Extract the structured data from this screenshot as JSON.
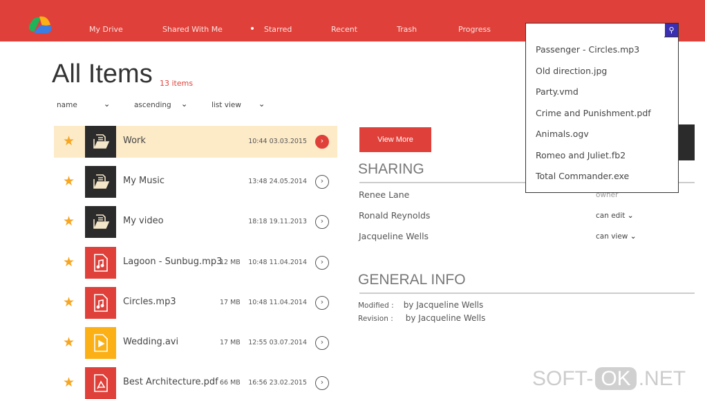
{
  "header": {
    "nav": [
      "My Drive",
      "Shared With Me",
      "Starred",
      "Recent",
      "Trash",
      "Progress"
    ],
    "search_value": "",
    "search_icon": "search-icon"
  },
  "search_suggestions": [
    "Passenger - Circles.mp3",
    "Old direction.jpg",
    "Party.vmd",
    "Crime and Punishment.pdf",
    "Animals.ogv",
    "Romeo and Juliet.fb2",
    "Total Commander.exe"
  ],
  "page": {
    "title": "All Items",
    "count": "13 items",
    "sort_field": "name",
    "sort_order": "ascending",
    "view": "list view"
  },
  "files": [
    {
      "name": "Work",
      "size": "",
      "date": "10:44 03.03.2015",
      "type": "folder",
      "color": "#2b2b2b"
    },
    {
      "name": "My Music",
      "size": "",
      "date": "13:48 24.05.2014",
      "type": "folder",
      "color": "#2b2b2b"
    },
    {
      "name": "My video",
      "size": "",
      "date": "18:18 19.11.2013",
      "type": "folder",
      "color": "#2b2b2b"
    },
    {
      "name": "Lagoon - Sunbug.mp3",
      "size": "12 MB",
      "date": "10:48 11.04.2014",
      "type": "audio",
      "color": "#e0403a"
    },
    {
      "name": "Circles.mp3",
      "size": "17 MB",
      "date": "10:48 11.04.2014",
      "type": "audio",
      "color": "#e0403a"
    },
    {
      "name": "Wedding.avi",
      "size": "17 MB",
      "date": "12:55 03.07.2014",
      "type": "video",
      "color": "#fbb016"
    },
    {
      "name": "Best Architecture.pdf",
      "size": "66 MB",
      "date": "16:56 23.02.2015",
      "type": "pdf",
      "color": "#e0403a"
    }
  ],
  "details": {
    "view_more": "View More",
    "sharing_title": "SHARING",
    "sharing": [
      {
        "name": "Renee Lane",
        "role": "owner"
      },
      {
        "name": "Ronald Reynolds",
        "role": "can edit"
      },
      {
        "name": "Jacqueline Wells",
        "role": "can view"
      }
    ],
    "general_title": "GENERAL INFO",
    "modified_label": "Modified :",
    "modified_value": "by  Jacqueline Wells",
    "revision_label": "Revision :",
    "revision_value": "by  Jacqueline Wells"
  },
  "watermark": {
    "a": "SOFT-",
    "b": "OK",
    "c": ".NET"
  }
}
